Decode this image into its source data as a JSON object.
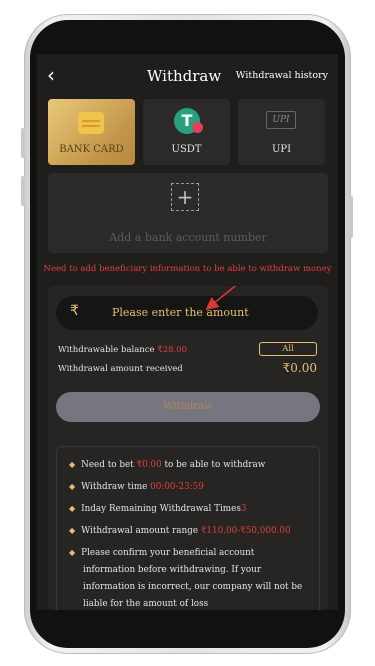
{
  "header": {
    "back_icon": "chevron-left-icon",
    "title": "Withdraw",
    "history_label": "Withdrawal history"
  },
  "tabs": [
    {
      "label": "BANK CARD",
      "icon": "bank-card-icon",
      "active": true
    },
    {
      "label": "USDT",
      "icon": "usdt-icon",
      "active": false
    },
    {
      "label": "UPI",
      "icon": "upi-icon",
      "active": false
    }
  ],
  "add_account": {
    "icon": "add-icon",
    "label": "Add a bank account number"
  },
  "warning": "Need to add beneficiary information to be able to withdraw money",
  "amount": {
    "currency_symbol": "₹",
    "placeholder": "Please enter the amount"
  },
  "balance": {
    "label": "Withdrawable balance",
    "value": "₹28.00",
    "all_label": "All"
  },
  "received": {
    "label": "Withdrawal amount received",
    "value": "₹0.00"
  },
  "withdraw_button": "Withdraw",
  "rules": [
    {
      "pre": "Need to bet ",
      "hl": "₹0.00",
      "post": " to be able to withdraw"
    },
    {
      "pre": "Withdraw time ",
      "hl": "00:00-23:59",
      "post": ""
    },
    {
      "pre": "Inday Remaining Withdrawal Times",
      "hl": "3",
      "post": ""
    },
    {
      "pre": "Withdrawal amount range ",
      "hl": "₹110.00-₹50,000.00",
      "post": ""
    },
    {
      "pre": "Please confirm your beneficial account information before withdrawing. If your information is incorrect, our company will not be liable for the amount of loss",
      "hl": "",
      "post": ""
    }
  ],
  "colors": {
    "background": "#1f1e1d",
    "accent_gold": "#e6c074",
    "warning_red": "#e0403a"
  }
}
